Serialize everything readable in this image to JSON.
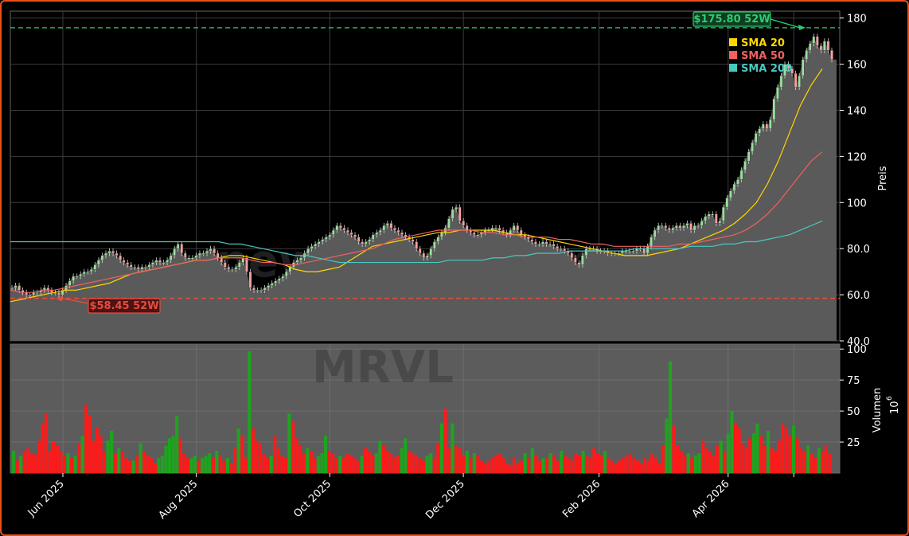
{
  "chart_data": {
    "type": "candlestick",
    "ticker": "MRVL",
    "watermark": "newsroom.com",
    "price_panel": {
      "ylabel": "Preis",
      "ylim": [
        40,
        183
      ],
      "yticks": [
        "40.0",
        "60.0",
        "80.0",
        "100",
        "120",
        "140",
        "160",
        "180"
      ],
      "ytick_values": [
        40,
        60,
        80,
        100,
        120,
        140,
        160,
        180
      ],
      "grid": true,
      "close_series": [
        63,
        64,
        62,
        61,
        60,
        60,
        61,
        61,
        62,
        63,
        62,
        61,
        61,
        60,
        62,
        64,
        66,
        68,
        68,
        69,
        70,
        70,
        71,
        73,
        75,
        77,
        78,
        79,
        78,
        77,
        75,
        74,
        73,
        72,
        72,
        71,
        72,
        72,
        73,
        74,
        75,
        74,
        74,
        75,
        77,
        80,
        82,
        78,
        76,
        76,
        76,
        77,
        78,
        78,
        79,
        80,
        78,
        76,
        74,
        72,
        71,
        71,
        72,
        74,
        76,
        70,
        63,
        62,
        62,
        62,
        63,
        64,
        65,
        66,
        67,
        68,
        70,
        72,
        74,
        75,
        76,
        78,
        80,
        81,
        82,
        83,
        84,
        85,
        86,
        88,
        90,
        89,
        88,
        87,
        86,
        85,
        83,
        82,
        83,
        84,
        86,
        87,
        88,
        90,
        91,
        89,
        88,
        87,
        86,
        85,
        84,
        83,
        80,
        78,
        76,
        77,
        80,
        83,
        85,
        87,
        89,
        93,
        97,
        98,
        92,
        90,
        88,
        87,
        86,
        86,
        87,
        88,
        88,
        89,
        89,
        88,
        87,
        86,
        88,
        90,
        88,
        86,
        85,
        84,
        83,
        82,
        82,
        83,
        82,
        82,
        81,
        80,
        80,
        79,
        78,
        76,
        74,
        73,
        77,
        80,
        80,
        80,
        79,
        79,
        79,
        78,
        78,
        78,
        78,
        79,
        79,
        79,
        79,
        80,
        80,
        78,
        81,
        85,
        88,
        90,
        90,
        89,
        88,
        89,
        90,
        89,
        90,
        91,
        88,
        90,
        90,
        92,
        94,
        95,
        95,
        91,
        92,
        98,
        102,
        105,
        108,
        110,
        114,
        118,
        122,
        126,
        130,
        132,
        134,
        132,
        136,
        145,
        150,
        155,
        160,
        158,
        156,
        150,
        155,
        162,
        166,
        169,
        172,
        168,
        166,
        170,
        166,
        162
      ],
      "series": [
        {
          "name": "SMA 20",
          "color": "#ffd700",
          "values": [
            57,
            58,
            59,
            60,
            61,
            62,
            62,
            63,
            64,
            65,
            67,
            69,
            70,
            71,
            72,
            73,
            74,
            75,
            75,
            76,
            77,
            77,
            76,
            75,
            74,
            73,
            71,
            70,
            70,
            71,
            72,
            75,
            78,
            81,
            82,
            83,
            84,
            85,
            86,
            87,
            87,
            88,
            88,
            88,
            88,
            87,
            86,
            86,
            85,
            84,
            83,
            82,
            81,
            80,
            79,
            78,
            77,
            77,
            77,
            78,
            79,
            80,
            82,
            84,
            86,
            88,
            91,
            95,
            100,
            108,
            118,
            130,
            142,
            151,
            158
          ]
        },
        {
          "name": "SMA 50",
          "color": "#f06060",
          "values": [
            62,
            61,
            61,
            62,
            62,
            63,
            64,
            65,
            66,
            67,
            68,
            69,
            70,
            71,
            72,
            73,
            74,
            75,
            75,
            76,
            76,
            76,
            75,
            74,
            74,
            73,
            73,
            74,
            75,
            76,
            77,
            78,
            79,
            80,
            82,
            84,
            85,
            86,
            87,
            88,
            88,
            88,
            88,
            87,
            87,
            86,
            86,
            85,
            85,
            85,
            84,
            84,
            83,
            82,
            82,
            81,
            81,
            81,
            81,
            81,
            81,
            82,
            82,
            83,
            84,
            85,
            86,
            88,
            91,
            95,
            100,
            106,
            112,
            118,
            122
          ]
        },
        {
          "name": "SMA 200",
          "color": "#48c9c0",
          "values": [
            83,
            83,
            83,
            83,
            83,
            83,
            83,
            83,
            83,
            83,
            83,
            83,
            83,
            83,
            83,
            83,
            83,
            83,
            83,
            83,
            82,
            82,
            81,
            80,
            79,
            78,
            77,
            77,
            76,
            75,
            74,
            74,
            74,
            74,
            74,
            74,
            74,
            74,
            74,
            74,
            75,
            75,
            75,
            75,
            76,
            76,
            77,
            77,
            78,
            78,
            78,
            79,
            79,
            79,
            79,
            79,
            79,
            80,
            80,
            80,
            80,
            80,
            81,
            81,
            81,
            82,
            82,
            83,
            83,
            84,
            85,
            86,
            88,
            90,
            92
          ]
        }
      ],
      "annotations": [
        {
          "label": "$175.80 52W",
          "value": 175.8,
          "color": "#2ecc71"
        },
        {
          "label": "$58.45 52W",
          "value": 58.45,
          "color": "#e74c3c"
        }
      ],
      "legend_placement": "top-right"
    },
    "volume_panel": {
      "ylabel": "Volumen",
      "unit_base": "10",
      "unit_exp": "6",
      "ylim": [
        0,
        104
      ],
      "yticks": [
        "25",
        "50",
        "75",
        "100"
      ],
      "ytick_values": [
        25,
        50,
        75,
        100
      ],
      "grid": true,
      "values": [
        18,
        10,
        14,
        18,
        20,
        16,
        15,
        26,
        40,
        48,
        18,
        25,
        22,
        18,
        14,
        16,
        12,
        14,
        24,
        30,
        55,
        46,
        26,
        37,
        30,
        18,
        26,
        34,
        16,
        20,
        18,
        12,
        10,
        10,
        14,
        24,
        18,
        14,
        12,
        8,
        12,
        14,
        22,
        28,
        30,
        46,
        28,
        16,
        12,
        12,
        14,
        10,
        12,
        14,
        16,
        12,
        18,
        14,
        10,
        12,
        8,
        20,
        36,
        30,
        12,
        98,
        36,
        26,
        24,
        16,
        12,
        14,
        30,
        20,
        14,
        12,
        48,
        42,
        28,
        22,
        16,
        20,
        18,
        12,
        14,
        16,
        30,
        18,
        16,
        12,
        14,
        12,
        16,
        14,
        12,
        10,
        14,
        20,
        18,
        14,
        16,
        26,
        22,
        18,
        16,
        12,
        14,
        20,
        28,
        18,
        16,
        14,
        12,
        10,
        14,
        16,
        12,
        24,
        40,
        52,
        20,
        40,
        22,
        20,
        14,
        18,
        12,
        16,
        14,
        10,
        8,
        10,
        12,
        14,
        16,
        12,
        8,
        6,
        12,
        8,
        10,
        16,
        12,
        20,
        14,
        10,
        12,
        12,
        16,
        14,
        10,
        18,
        14,
        12,
        10,
        16,
        14,
        18,
        14,
        12,
        20,
        16,
        14,
        18,
        12,
        10,
        8,
        10,
        12,
        14,
        16,
        12,
        10,
        8,
        12,
        10,
        16,
        12,
        8,
        22,
        44,
        90,
        38,
        22,
        18,
        14,
        16,
        12,
        14,
        16,
        26,
        20,
        18,
        14,
        22,
        26,
        18,
        32,
        50,
        40,
        36,
        24,
        20,
        28,
        32,
        40,
        30,
        22,
        34,
        20,
        18,
        26,
        40,
        36,
        30,
        38,
        28,
        20,
        18,
        22,
        16,
        12,
        20,
        18,
        22,
        16
      ]
    },
    "x_axis": {
      "labels": [
        "Jun 2025",
        "Aug 2025",
        "Oct 2025",
        "Dec 2025",
        "Feb 2026",
        "Apr 2026"
      ],
      "start": "2025-05-08",
      "end": "2026-05-22",
      "tick_dates": [
        "2025-06-01",
        "2025-08-01",
        "2025-10-01",
        "2025-12-01",
        "2026-02-01",
        "2026-04-01",
        "2026-05-01"
      ]
    },
    "colors": {
      "up": "#1fa31f",
      "down": "#ff1a1a",
      "area": "#5a5a5a",
      "background": "#000000",
      "grid": "#3c3c3c",
      "frame": "#e8501a"
    }
  }
}
